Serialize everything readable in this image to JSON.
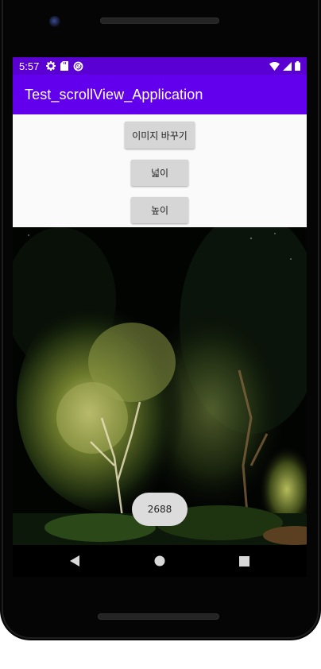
{
  "status_bar": {
    "time": "5:57",
    "left_icons": [
      "gear-icon",
      "sd-card-icon",
      "sync-icon"
    ],
    "right_icons": [
      "wifi-icon",
      "cellular-signal-icon",
      "battery-icon"
    ],
    "color": "#5a00d3"
  },
  "app_bar": {
    "title": "Test_scrollView_Application",
    "color": "#6200ee"
  },
  "buttons": {
    "change_image": "이미지 바꾸기",
    "width": "넓이",
    "height": "높이"
  },
  "image": {
    "icon": "night-forest-photo"
  },
  "toast": {
    "text": "2688"
  },
  "nav_bar": {
    "items": [
      "back-icon",
      "home-icon",
      "recents-icon"
    ]
  }
}
